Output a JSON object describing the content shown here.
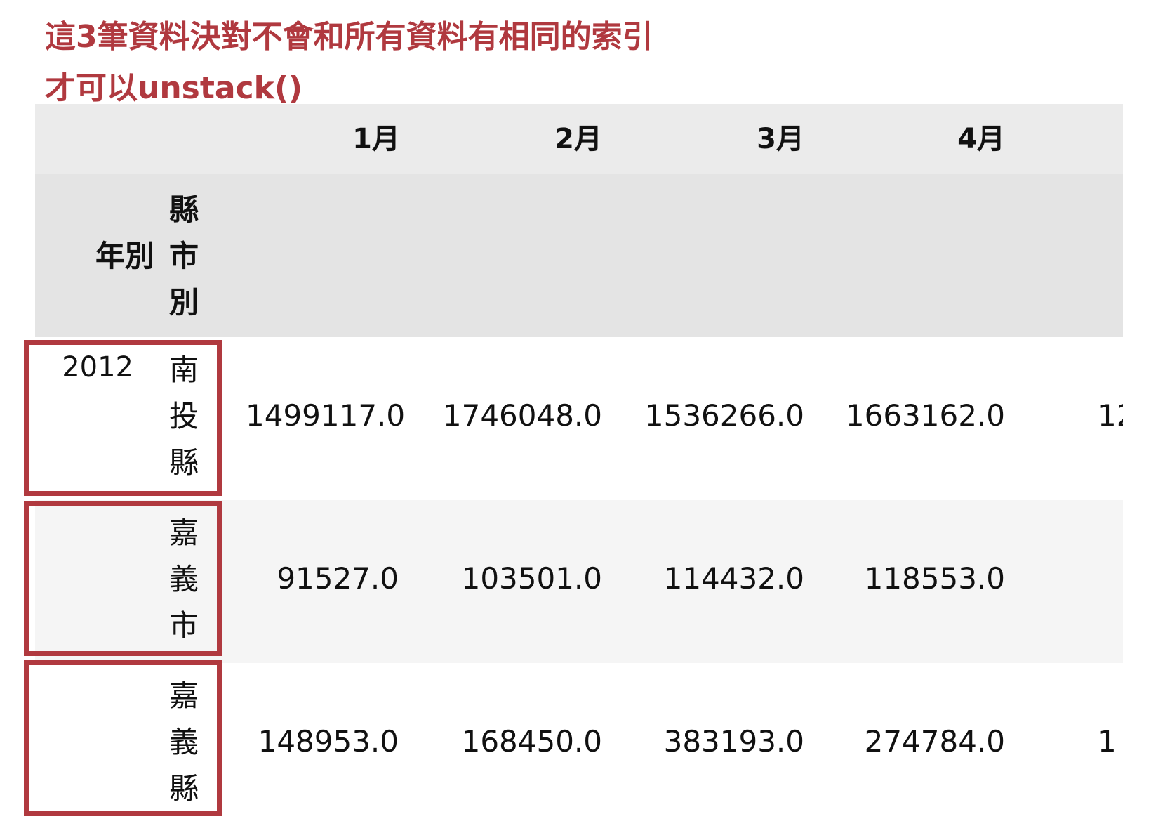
{
  "annotation": {
    "line1": "這3筆資料決對不會和所有資料有相同的索引",
    "line2": "才可以unstack()"
  },
  "table": {
    "columns": [
      "1月",
      "2月",
      "3月",
      "4月"
    ],
    "index_names": {
      "year": "年別",
      "county": [
        "縣",
        "市",
        "別"
      ]
    },
    "rows": [
      {
        "year": "2012",
        "county": [
          "南",
          "投",
          "縣"
        ],
        "values": [
          "1499117.0",
          "1746048.0",
          "1536266.0",
          "1663162.0"
        ],
        "cut_value": "12"
      },
      {
        "year": "",
        "county": [
          "嘉",
          "義",
          "市"
        ],
        "values": [
          "91527.0",
          "103501.0",
          "114432.0",
          "118553.0"
        ],
        "cut_value": ""
      },
      {
        "year": "",
        "county": [
          "嘉",
          "義",
          "縣"
        ],
        "values": [
          "148953.0",
          "168450.0",
          "383193.0",
          "274784.0"
        ],
        "cut_value": "1"
      }
    ],
    "highlight_color": "#b0393f"
  }
}
